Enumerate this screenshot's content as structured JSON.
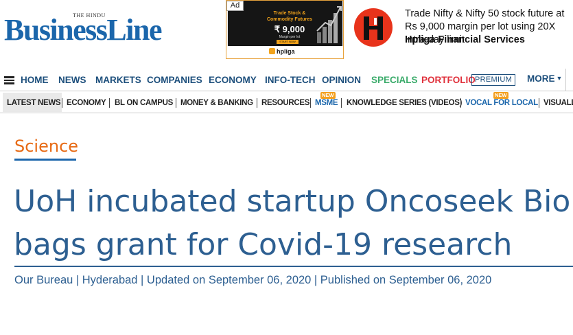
{
  "masthead": {
    "publisher": "THE HINDU",
    "brand": "BusinessLine"
  },
  "ad": {
    "label": "Ad",
    "headline": "Trade Stock & Commodity Futures",
    "price": "₹ 9,000",
    "price_sub": "Margin per lot",
    "cta": "START NOW",
    "footer_brand": "hpliga"
  },
  "sponsor": {
    "text": "Trade Nifty & Nifty 50 stock future at Rs 9,000 margin per lot using 20X Intra-day limit",
    "name": "Hpliga Financial Services"
  },
  "nav": {
    "items": [
      "HOME",
      "NEWS",
      "MARKETS",
      "COMPANIES",
      "ECONOMY",
      "INFO-TECH",
      "OPINION",
      "SPECIALS",
      "PORTFOLIO"
    ],
    "premium": "PREMIUM",
    "more": "MORE"
  },
  "subnav": {
    "items": [
      "LATEST NEWS",
      "ECONOMY",
      "BL ON CAMPUS",
      "MONEY & BANKING",
      "RESOURCES",
      "MSME",
      "KNOWLEDGE SERIES (VIDEOS)",
      "VOCAL FOR LOCAL",
      "VISUALL"
    ],
    "new_tag": "NEW"
  },
  "article": {
    "section": "Science",
    "headline_line1": "UoH incubated startup Oncoseek Bio",
    "headline_line2": "bags grant for Covid-19 research",
    "byline": "Our Bureau | Hyderabad | Updated on September 06, 2020 | Published on September 06, 2020"
  },
  "colors": {
    "brand_blue": "#1b66ab",
    "headline_blue": "#2d5f91",
    "section_orange": "#e76a14",
    "specials_green": "#3aab6a",
    "portfolio_red": "#e0303b"
  }
}
